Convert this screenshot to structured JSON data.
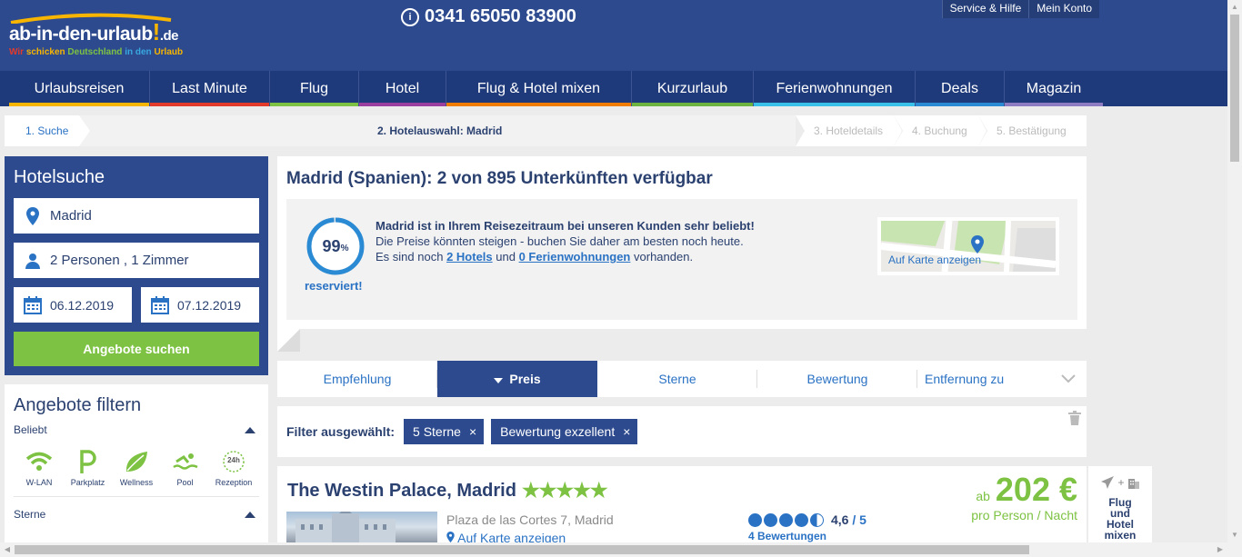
{
  "header": {
    "logo_text": "ab-in-den-urlaub",
    "logo_excl": "!",
    "logo_tld": ".de",
    "slogan": [
      "Wir",
      "schicken",
      "Deutschland",
      "in den",
      "Urlaub"
    ],
    "phone": "0341 65050 83900",
    "top_links": [
      "Service & Hilfe",
      "Mein Konto"
    ]
  },
  "nav": [
    {
      "label": "Urlaubsreisen",
      "color": "#f7b500"
    },
    {
      "label": "Last Minute",
      "color": "#e23a2b"
    },
    {
      "label": "Flug",
      "color": "#7dc242"
    },
    {
      "label": "Hotel",
      "color": "#9a3ea0"
    },
    {
      "label": "Flug & Hotel mixen",
      "color": "#f07d00"
    },
    {
      "label": "Kurzurlaub",
      "color": "#6cb33f"
    },
    {
      "label": "Ferienwohnungen",
      "color": "#38c0e8"
    },
    {
      "label": "Deals",
      "color": "#2a8ad4"
    },
    {
      "label": "Magazin",
      "color": "#8e7cc3"
    }
  ],
  "steps": {
    "s1": "1. Suche",
    "s2": "2. Hotelauswahl: Madrid",
    "s3": "3. Hoteldetails",
    "s4": "4. Buchung",
    "s5": "5. Bestätigung"
  },
  "search": {
    "title": "Hotelsuche",
    "destination": "Madrid",
    "persons": "2 Personen , 1 Zimmer",
    "date_from": "06.12.2019",
    "date_to": "07.12.2019",
    "button": "Angebote suchen"
  },
  "filter": {
    "title": "Angebote filtern",
    "section1": "Beliebt",
    "amenities": [
      "W-LAN",
      "Parkplatz",
      "Wellness",
      "Pool",
      "Rezeption"
    ],
    "reception_badge": "24h",
    "section2": "Sterne"
  },
  "main": {
    "title": "Madrid (Spanien): 2 von 895 Unterkünften verfügbar",
    "percent": "99",
    "percent_sign": "%",
    "percent_value": 0.99,
    "reserved": "reserviert!",
    "info_bold": "Madrid ist in Ihrem Reisezeitraum bei unseren Kunden sehr beliebt!",
    "info_line2": "Die Preise könnten steigen - buchen Sie daher am besten noch heute.",
    "info_prefix": "Es sind noch",
    "info_hotels": "2 Hotels",
    "info_and": "und",
    "info_fewo": "0 Ferienwohnungen",
    "info_suffix": "vorhanden.",
    "map_label": "Auf Karte anzeigen"
  },
  "sort": {
    "items": [
      "Empfehlung",
      "Preis",
      "Sterne",
      "Bewertung",
      "Entfernung zu"
    ]
  },
  "chips": {
    "label": "Filter ausgewählt:",
    "items": [
      "5 Sterne",
      "Bewertung exzellent"
    ],
    "remove": "×"
  },
  "hotel": {
    "name": "The Westin Palace, Madrid",
    "stars": "★★★★★",
    "address": "Plaza de las Cortes 7, Madrid",
    "map_link": "Auf Karte anzeigen",
    "rating": "4,6",
    "rating_max": "/ 5",
    "reviews": "4 Bewertungen",
    "price_prefix": "ab",
    "price": "202 €",
    "price_unit": "pro Person / Nacht"
  },
  "side_card": {
    "plus": "+",
    "label": [
      "Flug",
      "und",
      "Hotel",
      "mixen"
    ]
  }
}
